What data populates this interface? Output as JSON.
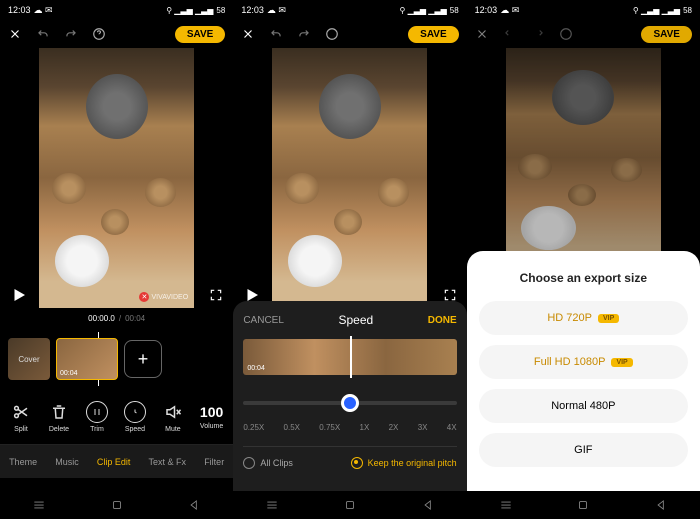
{
  "status": {
    "time": "12:03",
    "battery": "58"
  },
  "header": {
    "save": "SAVE"
  },
  "watermark": "VIVAVIDEO",
  "time": {
    "current": "00:00.0",
    "total": "00:04"
  },
  "cover": "Cover",
  "clip_dur": "00:04",
  "tools": {
    "split": "Split",
    "delete": "Delete",
    "trim": "Trim",
    "speed": "Speed",
    "mute": "Mute",
    "volume": "Volume",
    "volume_value": "100"
  },
  "tabs": {
    "theme": "Theme",
    "music": "Music",
    "clip": "Clip Edit",
    "text": "Text & Fx",
    "filter": "Filter"
  },
  "speed": {
    "cancel": "CANCEL",
    "title": "Speed",
    "done": "DONE",
    "dur": "00:04",
    "ticks": [
      "0.25X",
      "0.5X",
      "0.75X",
      "1X",
      "2X",
      "3X",
      "4X"
    ],
    "all": "All Clips",
    "pitch": "Keep the original pitch"
  },
  "export": {
    "title": "Choose an export size",
    "hd": "HD 720P",
    "vip": "VIP",
    "fhd": "Full HD 1080P",
    "normal": "Normal 480P",
    "gif": "GIF"
  }
}
